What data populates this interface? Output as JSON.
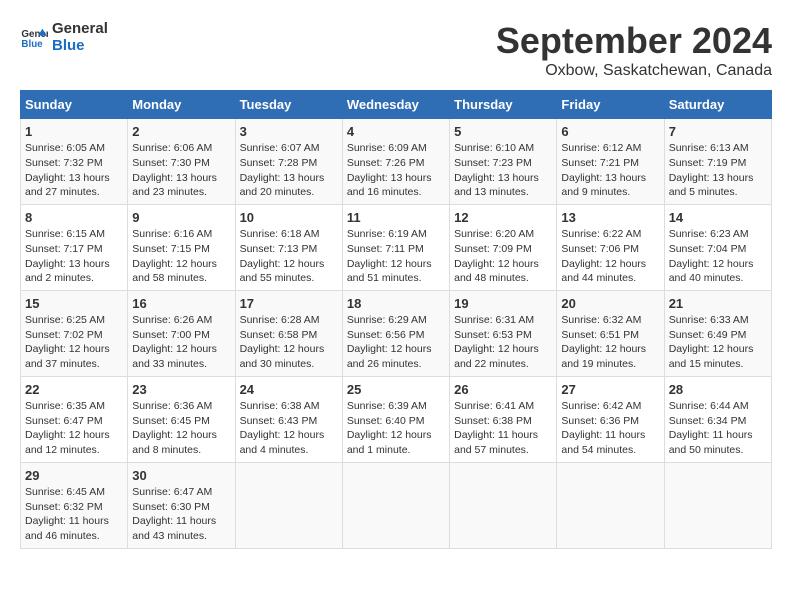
{
  "header": {
    "logo_line1": "General",
    "logo_line2": "Blue",
    "title": "September 2024",
    "subtitle": "Oxbow, Saskatchewan, Canada"
  },
  "weekdays": [
    "Sunday",
    "Monday",
    "Tuesday",
    "Wednesday",
    "Thursday",
    "Friday",
    "Saturday"
  ],
  "weeks": [
    [
      {
        "day": "1",
        "sunrise": "6:05 AM",
        "sunset": "7:32 PM",
        "daylight": "13 hours and 27 minutes."
      },
      {
        "day": "2",
        "sunrise": "6:06 AM",
        "sunset": "7:30 PM",
        "daylight": "13 hours and 23 minutes."
      },
      {
        "day": "3",
        "sunrise": "6:07 AM",
        "sunset": "7:28 PM",
        "daylight": "13 hours and 20 minutes."
      },
      {
        "day": "4",
        "sunrise": "6:09 AM",
        "sunset": "7:26 PM",
        "daylight": "13 hours and 16 minutes."
      },
      {
        "day": "5",
        "sunrise": "6:10 AM",
        "sunset": "7:23 PM",
        "daylight": "13 hours and 13 minutes."
      },
      {
        "day": "6",
        "sunrise": "6:12 AM",
        "sunset": "7:21 PM",
        "daylight": "13 hours and 9 minutes."
      },
      {
        "day": "7",
        "sunrise": "6:13 AM",
        "sunset": "7:19 PM",
        "daylight": "13 hours and 5 minutes."
      }
    ],
    [
      {
        "day": "8",
        "sunrise": "6:15 AM",
        "sunset": "7:17 PM",
        "daylight": "13 hours and 2 minutes."
      },
      {
        "day": "9",
        "sunrise": "6:16 AM",
        "sunset": "7:15 PM",
        "daylight": "12 hours and 58 minutes."
      },
      {
        "day": "10",
        "sunrise": "6:18 AM",
        "sunset": "7:13 PM",
        "daylight": "12 hours and 55 minutes."
      },
      {
        "day": "11",
        "sunrise": "6:19 AM",
        "sunset": "7:11 PM",
        "daylight": "12 hours and 51 minutes."
      },
      {
        "day": "12",
        "sunrise": "6:20 AM",
        "sunset": "7:09 PM",
        "daylight": "12 hours and 48 minutes."
      },
      {
        "day": "13",
        "sunrise": "6:22 AM",
        "sunset": "7:06 PM",
        "daylight": "12 hours and 44 minutes."
      },
      {
        "day": "14",
        "sunrise": "6:23 AM",
        "sunset": "7:04 PM",
        "daylight": "12 hours and 40 minutes."
      }
    ],
    [
      {
        "day": "15",
        "sunrise": "6:25 AM",
        "sunset": "7:02 PM",
        "daylight": "12 hours and 37 minutes."
      },
      {
        "day": "16",
        "sunrise": "6:26 AM",
        "sunset": "7:00 PM",
        "daylight": "12 hours and 33 minutes."
      },
      {
        "day": "17",
        "sunrise": "6:28 AM",
        "sunset": "6:58 PM",
        "daylight": "12 hours and 30 minutes."
      },
      {
        "day": "18",
        "sunrise": "6:29 AM",
        "sunset": "6:56 PM",
        "daylight": "12 hours and 26 minutes."
      },
      {
        "day": "19",
        "sunrise": "6:31 AM",
        "sunset": "6:53 PM",
        "daylight": "12 hours and 22 minutes."
      },
      {
        "day": "20",
        "sunrise": "6:32 AM",
        "sunset": "6:51 PM",
        "daylight": "12 hours and 19 minutes."
      },
      {
        "day": "21",
        "sunrise": "6:33 AM",
        "sunset": "6:49 PM",
        "daylight": "12 hours and 15 minutes."
      }
    ],
    [
      {
        "day": "22",
        "sunrise": "6:35 AM",
        "sunset": "6:47 PM",
        "daylight": "12 hours and 12 minutes."
      },
      {
        "day": "23",
        "sunrise": "6:36 AM",
        "sunset": "6:45 PM",
        "daylight": "12 hours and 8 minutes."
      },
      {
        "day": "24",
        "sunrise": "6:38 AM",
        "sunset": "6:43 PM",
        "daylight": "12 hours and 4 minutes."
      },
      {
        "day": "25",
        "sunrise": "6:39 AM",
        "sunset": "6:40 PM",
        "daylight": "12 hours and 1 minute."
      },
      {
        "day": "26",
        "sunrise": "6:41 AM",
        "sunset": "6:38 PM",
        "daylight": "11 hours and 57 minutes."
      },
      {
        "day": "27",
        "sunrise": "6:42 AM",
        "sunset": "6:36 PM",
        "daylight": "11 hours and 54 minutes."
      },
      {
        "day": "28",
        "sunrise": "6:44 AM",
        "sunset": "6:34 PM",
        "daylight": "11 hours and 50 minutes."
      }
    ],
    [
      {
        "day": "29",
        "sunrise": "6:45 AM",
        "sunset": "6:32 PM",
        "daylight": "11 hours and 46 minutes."
      },
      {
        "day": "30",
        "sunrise": "6:47 AM",
        "sunset": "6:30 PM",
        "daylight": "11 hours and 43 minutes."
      },
      null,
      null,
      null,
      null,
      null
    ]
  ],
  "labels": {
    "sunrise": "Sunrise:",
    "sunset": "Sunset:",
    "daylight": "Daylight:"
  }
}
